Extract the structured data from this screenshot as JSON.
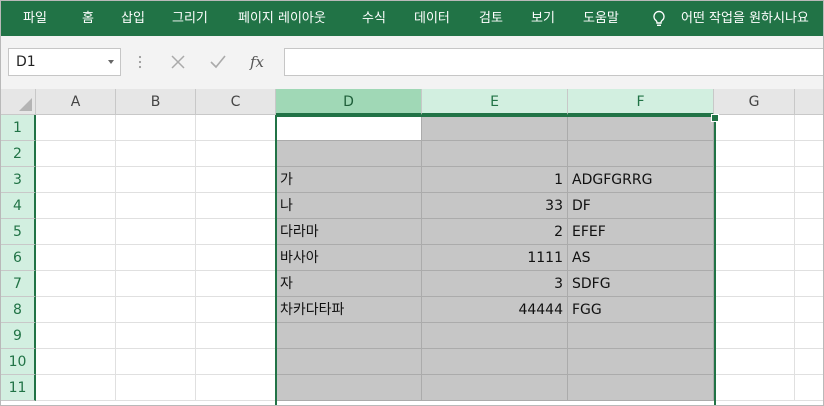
{
  "ribbon": {
    "tabs": [
      "파일",
      "홈",
      "삽입",
      "그리기",
      "페이지 레이아웃",
      "수식",
      "데이터",
      "검토",
      "보기",
      "도움말"
    ],
    "tell_me": "어떤 작업을 원하시나요"
  },
  "formula_bar": {
    "name_box": "D1",
    "fx_label": "fx",
    "formula": ""
  },
  "sheet": {
    "columns": [
      "A",
      "B",
      "C",
      "D",
      "E",
      "F",
      "G"
    ],
    "rows": [
      "1",
      "2",
      "3",
      "4",
      "5",
      "6",
      "7",
      "8",
      "9",
      "10",
      "11"
    ],
    "selected_range": "D1:F11",
    "active_cell": "D1",
    "cells": [
      {
        "ref": "D3",
        "value": "가"
      },
      {
        "ref": "E3",
        "value": "1"
      },
      {
        "ref": "F3",
        "value": "ADGFGRRG"
      },
      {
        "ref": "D4",
        "value": "나"
      },
      {
        "ref": "E4",
        "value": "33"
      },
      {
        "ref": "F4",
        "value": "DF"
      },
      {
        "ref": "D5",
        "value": "다라마"
      },
      {
        "ref": "E5",
        "value": "2"
      },
      {
        "ref": "F5",
        "value": "EFEF"
      },
      {
        "ref": "D6",
        "value": "바사아"
      },
      {
        "ref": "E6",
        "value": "1111"
      },
      {
        "ref": "F6",
        "value": "AS"
      },
      {
        "ref": "D7",
        "value": "자"
      },
      {
        "ref": "E7",
        "value": "3"
      },
      {
        "ref": "F7",
        "value": "SDFG"
      },
      {
        "ref": "D8",
        "value": "차카다타파"
      },
      {
        "ref": "E8",
        "value": "44444"
      },
      {
        "ref": "F8",
        "value": "FGG"
      }
    ]
  },
  "colors": {
    "ribbon": "#217346",
    "selection_fill": "#c6c6c6",
    "selection_border": "#217346"
  }
}
